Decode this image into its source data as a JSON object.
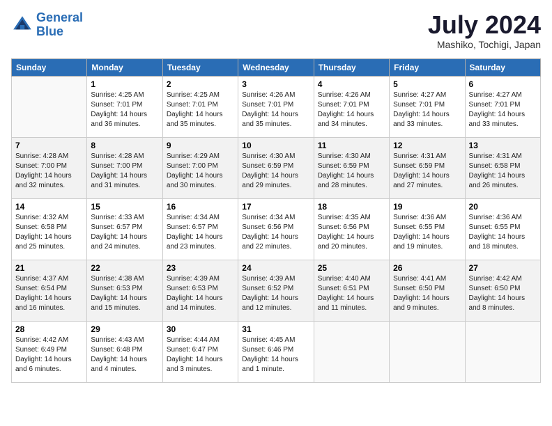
{
  "header": {
    "logo_line1": "General",
    "logo_line2": "Blue",
    "month_year": "July 2024",
    "location": "Mashiko, Tochigi, Japan"
  },
  "days_of_week": [
    "Sunday",
    "Monday",
    "Tuesday",
    "Wednesday",
    "Thursday",
    "Friday",
    "Saturday"
  ],
  "weeks": [
    [
      {
        "day": "",
        "text": ""
      },
      {
        "day": "1",
        "text": "Sunrise: 4:25 AM\nSunset: 7:01 PM\nDaylight: 14 hours\nand 36 minutes."
      },
      {
        "day": "2",
        "text": "Sunrise: 4:25 AM\nSunset: 7:01 PM\nDaylight: 14 hours\nand 35 minutes."
      },
      {
        "day": "3",
        "text": "Sunrise: 4:26 AM\nSunset: 7:01 PM\nDaylight: 14 hours\nand 35 minutes."
      },
      {
        "day": "4",
        "text": "Sunrise: 4:26 AM\nSunset: 7:01 PM\nDaylight: 14 hours\nand 34 minutes."
      },
      {
        "day": "5",
        "text": "Sunrise: 4:27 AM\nSunset: 7:01 PM\nDaylight: 14 hours\nand 33 minutes."
      },
      {
        "day": "6",
        "text": "Sunrise: 4:27 AM\nSunset: 7:01 PM\nDaylight: 14 hours\nand 33 minutes."
      }
    ],
    [
      {
        "day": "7",
        "text": "Sunrise: 4:28 AM\nSunset: 7:00 PM\nDaylight: 14 hours\nand 32 minutes."
      },
      {
        "day": "8",
        "text": "Sunrise: 4:28 AM\nSunset: 7:00 PM\nDaylight: 14 hours\nand 31 minutes."
      },
      {
        "day": "9",
        "text": "Sunrise: 4:29 AM\nSunset: 7:00 PM\nDaylight: 14 hours\nand 30 minutes."
      },
      {
        "day": "10",
        "text": "Sunrise: 4:30 AM\nSunset: 6:59 PM\nDaylight: 14 hours\nand 29 minutes."
      },
      {
        "day": "11",
        "text": "Sunrise: 4:30 AM\nSunset: 6:59 PM\nDaylight: 14 hours\nand 28 minutes."
      },
      {
        "day": "12",
        "text": "Sunrise: 4:31 AM\nSunset: 6:59 PM\nDaylight: 14 hours\nand 27 minutes."
      },
      {
        "day": "13",
        "text": "Sunrise: 4:31 AM\nSunset: 6:58 PM\nDaylight: 14 hours\nand 26 minutes."
      }
    ],
    [
      {
        "day": "14",
        "text": "Sunrise: 4:32 AM\nSunset: 6:58 PM\nDaylight: 14 hours\nand 25 minutes."
      },
      {
        "day": "15",
        "text": "Sunrise: 4:33 AM\nSunset: 6:57 PM\nDaylight: 14 hours\nand 24 minutes."
      },
      {
        "day": "16",
        "text": "Sunrise: 4:34 AM\nSunset: 6:57 PM\nDaylight: 14 hours\nand 23 minutes."
      },
      {
        "day": "17",
        "text": "Sunrise: 4:34 AM\nSunset: 6:56 PM\nDaylight: 14 hours\nand 22 minutes."
      },
      {
        "day": "18",
        "text": "Sunrise: 4:35 AM\nSunset: 6:56 PM\nDaylight: 14 hours\nand 20 minutes."
      },
      {
        "day": "19",
        "text": "Sunrise: 4:36 AM\nSunset: 6:55 PM\nDaylight: 14 hours\nand 19 minutes."
      },
      {
        "day": "20",
        "text": "Sunrise: 4:36 AM\nSunset: 6:55 PM\nDaylight: 14 hours\nand 18 minutes."
      }
    ],
    [
      {
        "day": "21",
        "text": "Sunrise: 4:37 AM\nSunset: 6:54 PM\nDaylight: 14 hours\nand 16 minutes."
      },
      {
        "day": "22",
        "text": "Sunrise: 4:38 AM\nSunset: 6:53 PM\nDaylight: 14 hours\nand 15 minutes."
      },
      {
        "day": "23",
        "text": "Sunrise: 4:39 AM\nSunset: 6:53 PM\nDaylight: 14 hours\nand 14 minutes."
      },
      {
        "day": "24",
        "text": "Sunrise: 4:39 AM\nSunset: 6:52 PM\nDaylight: 14 hours\nand 12 minutes."
      },
      {
        "day": "25",
        "text": "Sunrise: 4:40 AM\nSunset: 6:51 PM\nDaylight: 14 hours\nand 11 minutes."
      },
      {
        "day": "26",
        "text": "Sunrise: 4:41 AM\nSunset: 6:50 PM\nDaylight: 14 hours\nand 9 minutes."
      },
      {
        "day": "27",
        "text": "Sunrise: 4:42 AM\nSunset: 6:50 PM\nDaylight: 14 hours\nand 8 minutes."
      }
    ],
    [
      {
        "day": "28",
        "text": "Sunrise: 4:42 AM\nSunset: 6:49 PM\nDaylight: 14 hours\nand 6 minutes."
      },
      {
        "day": "29",
        "text": "Sunrise: 4:43 AM\nSunset: 6:48 PM\nDaylight: 14 hours\nand 4 minutes."
      },
      {
        "day": "30",
        "text": "Sunrise: 4:44 AM\nSunset: 6:47 PM\nDaylight: 14 hours\nand 3 minutes."
      },
      {
        "day": "31",
        "text": "Sunrise: 4:45 AM\nSunset: 6:46 PM\nDaylight: 14 hours\nand 1 minute."
      },
      {
        "day": "",
        "text": ""
      },
      {
        "day": "",
        "text": ""
      },
      {
        "day": "",
        "text": ""
      }
    ]
  ]
}
